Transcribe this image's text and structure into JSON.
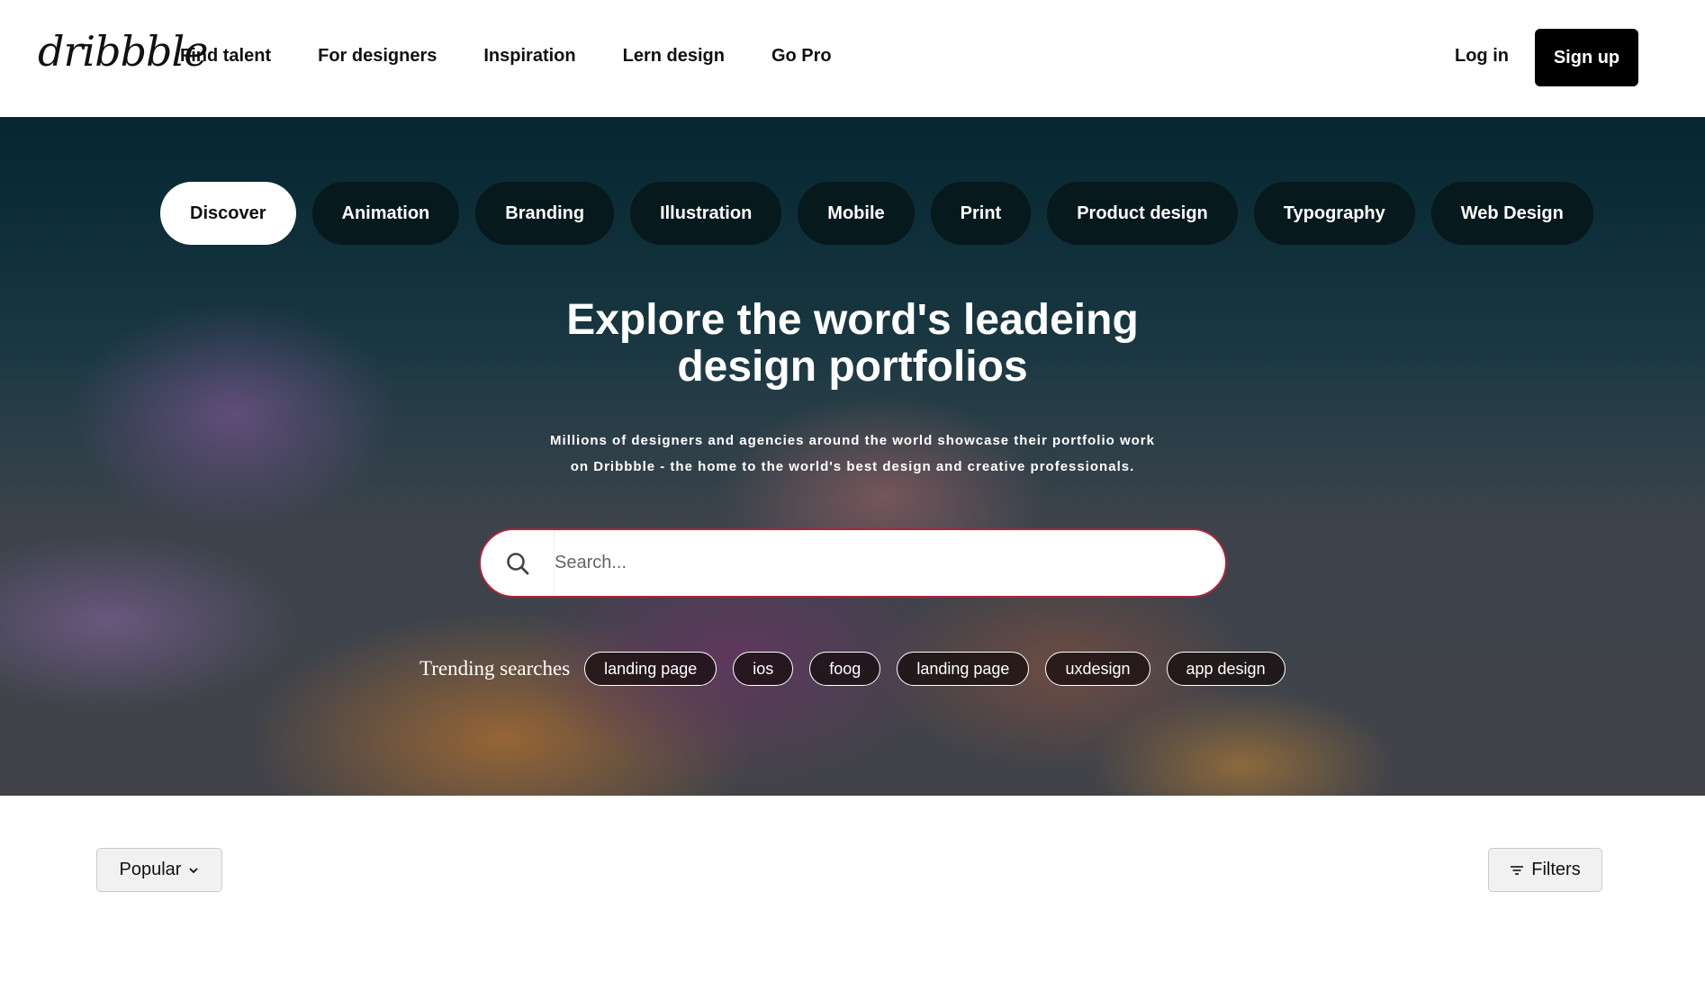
{
  "header": {
    "logo": "dribbble",
    "nav": [
      "Find talent",
      "For designers",
      "Inspiration",
      "Lern design",
      "Go Pro"
    ],
    "login_label": "Log in",
    "signup_label": "Sign up"
  },
  "hero": {
    "categories": [
      "Discover",
      "Animation",
      "Branding",
      "Illustration",
      "Mobile",
      "Print",
      "Product design",
      "Typography",
      "Web Design"
    ],
    "active_category": "Discover",
    "title_line1": "Explore the word's leadeing",
    "title_line2": "design portfolios",
    "subtitle_line1": "Millions of designers and agencies around the world showcase their portfolio work",
    "subtitle_line2": "on Dribbble - the home to the world's best design and creative professionals.",
    "search": {
      "placeholder": "Search...",
      "value": ""
    },
    "trending_label": "Trending searches",
    "trending": [
      "landing page",
      "ios",
      "foog",
      "landing page",
      "uxdesign",
      "app design"
    ]
  },
  "toolbar": {
    "sort_label": "Popular",
    "filters_label": "Filters"
  }
}
